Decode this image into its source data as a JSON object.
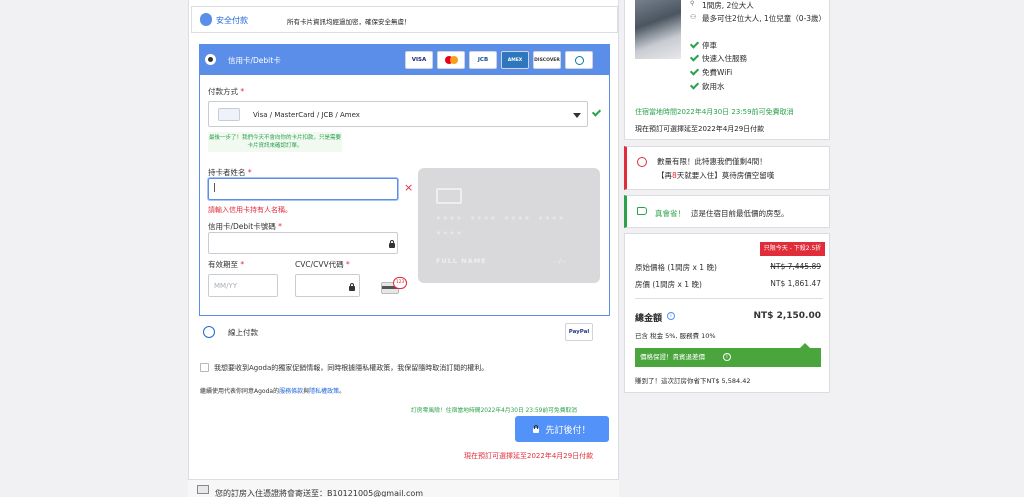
{
  "secure_bar": {
    "title": "安全付款",
    "note": "所有卡片資訊均經過加密，確保安全無虞！"
  },
  "card_option": {
    "title": "信用卡/Debit卡",
    "logos": [
      "VISA",
      "MC",
      "JCB",
      "AMEX",
      "DISCOVER",
      "DINERS"
    ]
  },
  "payment_method": {
    "label": "付款方式",
    "required": "*",
    "value": "Visa / MasterCard / JCB / Amex",
    "hint": "最後一步了！我們今天不會向你的卡片扣款，只是需要卡片資訊來確認訂單。"
  },
  "holder_name": {
    "label": "持卡者姓名",
    "required": "*",
    "error": "請輸入信用卡持有人名稱。",
    "value": "|"
  },
  "card_number": {
    "label": "信用卡/Debit卡號碼",
    "required": "*"
  },
  "expiry": {
    "label": "有效期至",
    "required": "*",
    "placeholder": "MM/YY"
  },
  "cvc": {
    "label": "CVC/CVV代碼",
    "required": "*",
    "sample": "123"
  },
  "card_preview": {
    "number_mask": "**** **** **** ****",
    "cvc_mask": "****",
    "name": "FULL NAME",
    "expiry_mask": "--/--"
  },
  "online_option": {
    "title": "線上付款",
    "paypal": "PayPal"
  },
  "promo_checkbox": {
    "label": "我想要收到Agoda的獨家促銷情報，同時根據隱私權政策，我保留隨時取消訂閱的權利。"
  },
  "terms": {
    "prefix": "繼續使用代表你同意Agoda的",
    "service": "服務條款",
    "and": "與",
    "privacy": "隱私權政策",
    "suffix": "。"
  },
  "free_cancel": "訂房零風險！住宿當地時間2022年4月30日 23:59前可免費取消",
  "book_button": "先訂後付！",
  "extend_note": "現在預訂可選擇延至2022年4月29日付款",
  "email_notice": {
    "prefix": "您的訂房入住憑證將會寄送至：",
    "email": "B10121005@gmail.com"
  },
  "room": {
    "occupancy": "1間房, 2位大人",
    "capacity": "最多可住2位大人, 1位兒童（0-3歲）",
    "amenities": [
      "停車",
      "快速入住服務",
      "免費WiFi",
      "飲用水"
    ],
    "free_cancel": "住宿當地時間2022年4月30日 23:59前可免費取消",
    "pay_later": "現在預訂可選擇延至2022年4月29日付款"
  },
  "urgency": {
    "line1": "數量有限！此特惠我們僅剩4間！",
    "line2_prefix": "【再",
    "line2_days": "8",
    "line2_suffix": "天就要入住】莫待房價空留嘆"
  },
  "deal": {
    "title": "真會省！",
    "text": "這是住宿目前最低價的房型。"
  },
  "price": {
    "badge": "只限今天 - 下殺2.5折",
    "original_label": "原始價格 (1間房 x 1 晚)",
    "original_value": "NT$ 7,445.89",
    "room_label": "房價 (1間房 x 1 晚)",
    "room_value": "NT$ 1,861.47",
    "total_label": "總金額",
    "total_value": "NT$ 2,150.00",
    "tax_note": "已含 稅金 5%, 服務費 10%",
    "guarantee": "價格保證！貴賓退差價",
    "saved": "賺到了！這次訂房你省下NT$ 5,584.42"
  },
  "colors": {
    "primary": "#5b8ee9",
    "button": "#5392f9",
    "green": "#2aa24a",
    "red": "#e12d39"
  }
}
